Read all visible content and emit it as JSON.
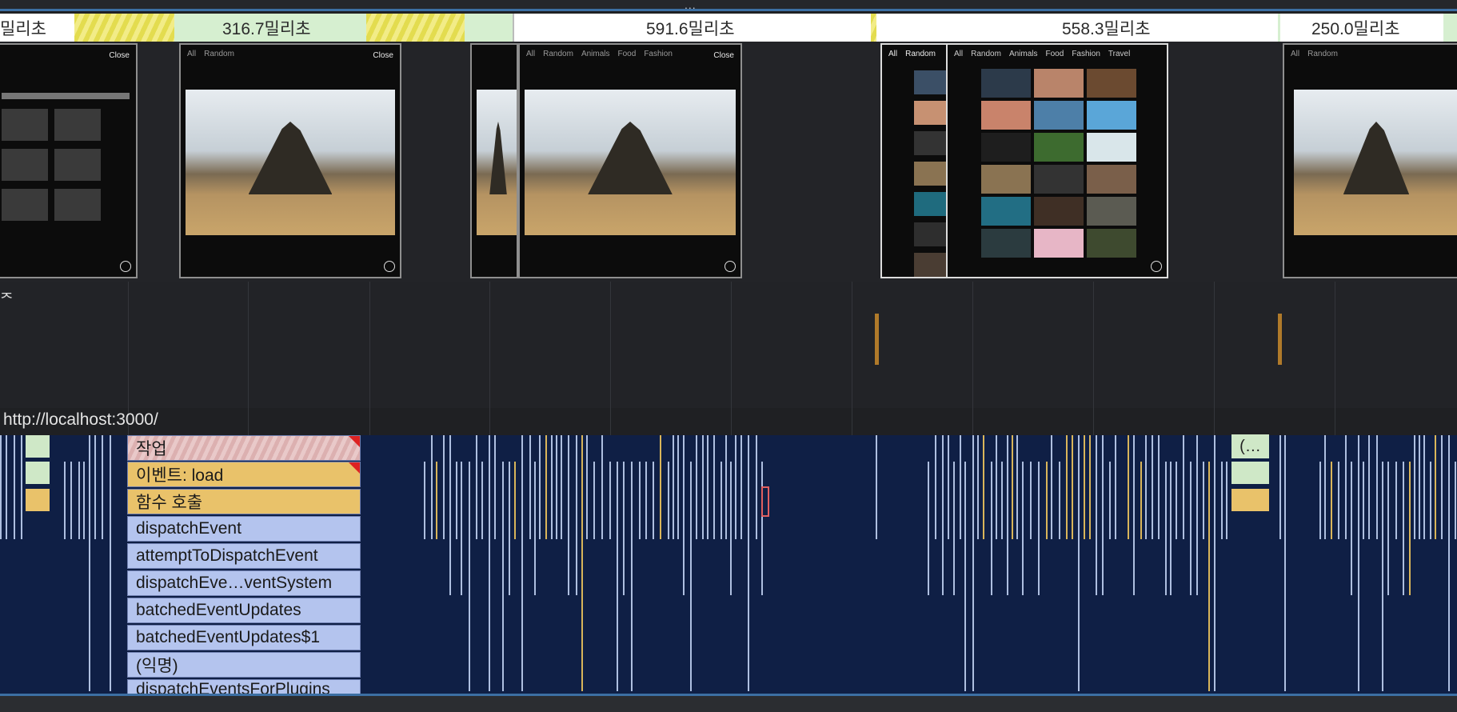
{
  "top_grip": "...",
  "frames": [
    {
      "label": "밀리초"
    },
    {
      "label": "316.7밀리초"
    },
    {
      "label": "591.6밀리초"
    },
    {
      "label": "558.3밀리초"
    },
    {
      "label": "250.0밀리초"
    }
  ],
  "screenshot": {
    "close_label": "Close",
    "nav": [
      "All",
      "Random",
      "Animals",
      "Food",
      "Fashion",
      "Travel"
    ]
  },
  "network": {
    "cut_label": "ᄌ"
  },
  "main_thread_url": "http://localhost:3000/",
  "flame": {
    "entries": [
      {
        "label": "작업"
      },
      {
        "label": "이벤트: load"
      },
      {
        "label": "함수 호출"
      },
      {
        "label": "dispatchEvent"
      },
      {
        "label": "attemptToDispatchEvent"
      },
      {
        "label": "dispatchEve…ventSystem"
      },
      {
        "label": "batchedEventUpdates"
      },
      {
        "label": "batchedEventUpdates$1"
      },
      {
        "label": "(익명)"
      },
      {
        "label": "dispatchEventsForPlugins"
      }
    ],
    "collapsed_label": "(…"
  },
  "colors": {
    "flame_bg": "#0f1f45",
    "task": "#dcb0b0",
    "event": "#e9c26a",
    "script": "#b4c4ee",
    "frame_green": "#d6efd0",
    "frame_idle": "#ffffff",
    "accent": "#3c6fa3"
  }
}
